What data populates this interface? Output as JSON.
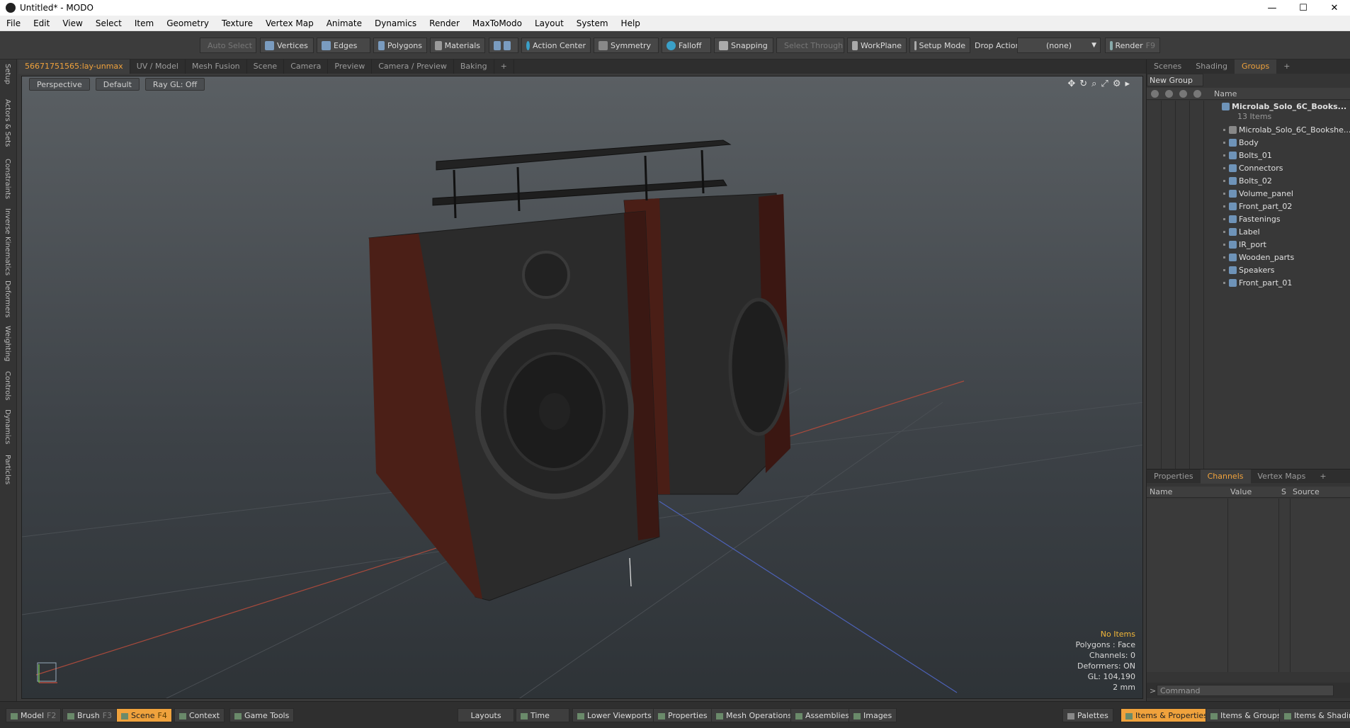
{
  "window": {
    "title": "Untitled* - MODO",
    "minimize": "—",
    "maximize": "☐",
    "close": "✕"
  },
  "menu": [
    "File",
    "Edit",
    "View",
    "Select",
    "Item",
    "Geometry",
    "Texture",
    "Vertex Map",
    "Animate",
    "Dynamics",
    "Render",
    "MaxToModo",
    "Layout",
    "System",
    "Help"
  ],
  "toolbar": {
    "auto_select": "Auto Select",
    "vertices": "Vertices",
    "edges": "Edges",
    "polygons": "Polygons",
    "materials": "Materials",
    "action_center": "Action Center",
    "symmetry": "Symmetry",
    "falloff": "Falloff",
    "snapping": "Snapping",
    "select_through": "Select Through",
    "workplane": "WorkPlane",
    "setup_mode": "Setup Mode",
    "drop_action_label": "Drop Action",
    "drop_action_value": "(none)",
    "render": "Render",
    "render_key": "F9"
  },
  "left_tabs": [
    "Setup",
    "Actors & Sets",
    "Constraints",
    "Inverse Kinematics",
    "Deformers",
    "Weighting",
    "Controls",
    "Dynamics",
    "Particles"
  ],
  "viewport_tabs": [
    "56671751565:lay-unmax",
    "UV / Model",
    "Mesh Fusion",
    "Scene",
    "Camera",
    "Preview",
    "Camera / Preview",
    "Baking",
    "+"
  ],
  "viewport": {
    "view": "Perspective",
    "shading": "Default",
    "raygl": "Ray GL: Off",
    "info": {
      "items": "No Items",
      "polygons": "Polygons : Face",
      "channels": "Channels: 0",
      "deformers": "Deformers: ON",
      "gl": "GL: 104,190",
      "scale": "2 mm"
    }
  },
  "right_panel": {
    "tabs": [
      "Scenes",
      "Shading",
      "Groups",
      "+"
    ],
    "new_group": "New Group",
    "name_col": "Name",
    "root": {
      "label": "Microlab_Solo_6C_Books...",
      "count": "13 Items"
    },
    "items": [
      "Microlab_Solo_6C_Bookshe...",
      "Body",
      "Bolts_01",
      "Connectors",
      "Bolts_02",
      "Volume_panel",
      "Front_part_02",
      "Fastenings",
      "Label",
      "IR_port",
      "Wooden_parts",
      "Speakers",
      "Front_part_01"
    ]
  },
  "bottom_right": {
    "tabs": [
      "Properties",
      "Channels",
      "Vertex Maps",
      "+"
    ],
    "columns": {
      "name": "Name",
      "value": "Value",
      "s": "S",
      "source": "Source"
    },
    "command_placeholder": "Command"
  },
  "bottom_bar": {
    "model": "Model",
    "model_key": "F2",
    "brush": "Brush",
    "brush_key": "F3",
    "scene": "Scene",
    "scene_key": "F4",
    "context": "Context",
    "game_tools": "Game Tools",
    "layouts": "Layouts",
    "time": "Time",
    "lower_viewports": "Lower Viewports",
    "properties": "Properties",
    "mesh_operations": "Mesh Operations",
    "assemblies": "Assemblies",
    "images": "Images",
    "palettes": "Palettes",
    "items_properties": "Items & Properties",
    "items_groups": "Items & Groups",
    "items_shading": "Items & Shading"
  }
}
